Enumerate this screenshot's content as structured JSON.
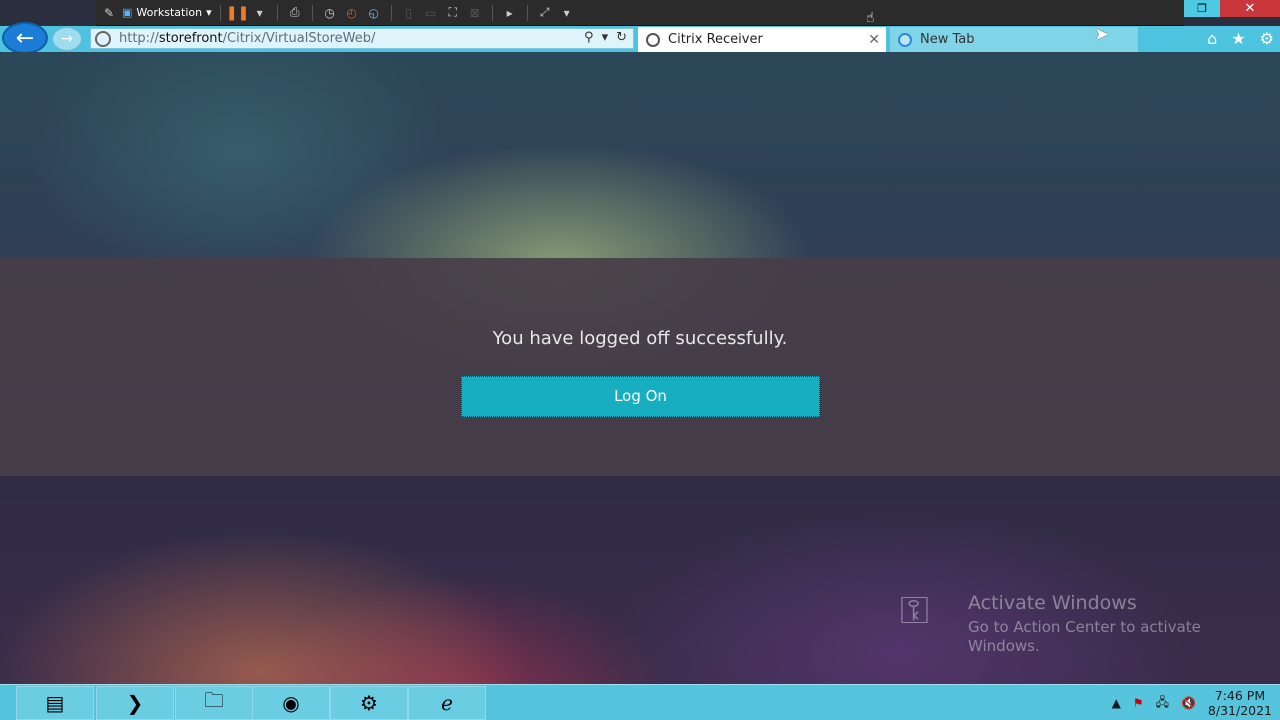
{
  "vm_toolbar": {
    "vm_name": "Workstation"
  },
  "browser": {
    "url_prefix": "http://",
    "url_host": "storefront",
    "url_path": "/Citrix/VirtualStoreWeb/",
    "tabs": [
      {
        "label": "Citrix Receiver",
        "active": true
      },
      {
        "label": "New Tab",
        "active": false
      }
    ]
  },
  "page": {
    "message": "You have logged off successfully.",
    "logon_label": "Log On",
    "accent_color": "#18aec2"
  },
  "watermark": {
    "title": "Activate Windows",
    "subtitle": "Go to Action Center to activate Windows."
  },
  "taskbar": {
    "items": [
      "server-manager-icon",
      "powershell-icon",
      "file-explorer-icon",
      "chrome-icon",
      "settings-gears-icon",
      "internet-explorer-icon"
    ],
    "time": "7:46 PM",
    "date": "8/31/2021"
  }
}
